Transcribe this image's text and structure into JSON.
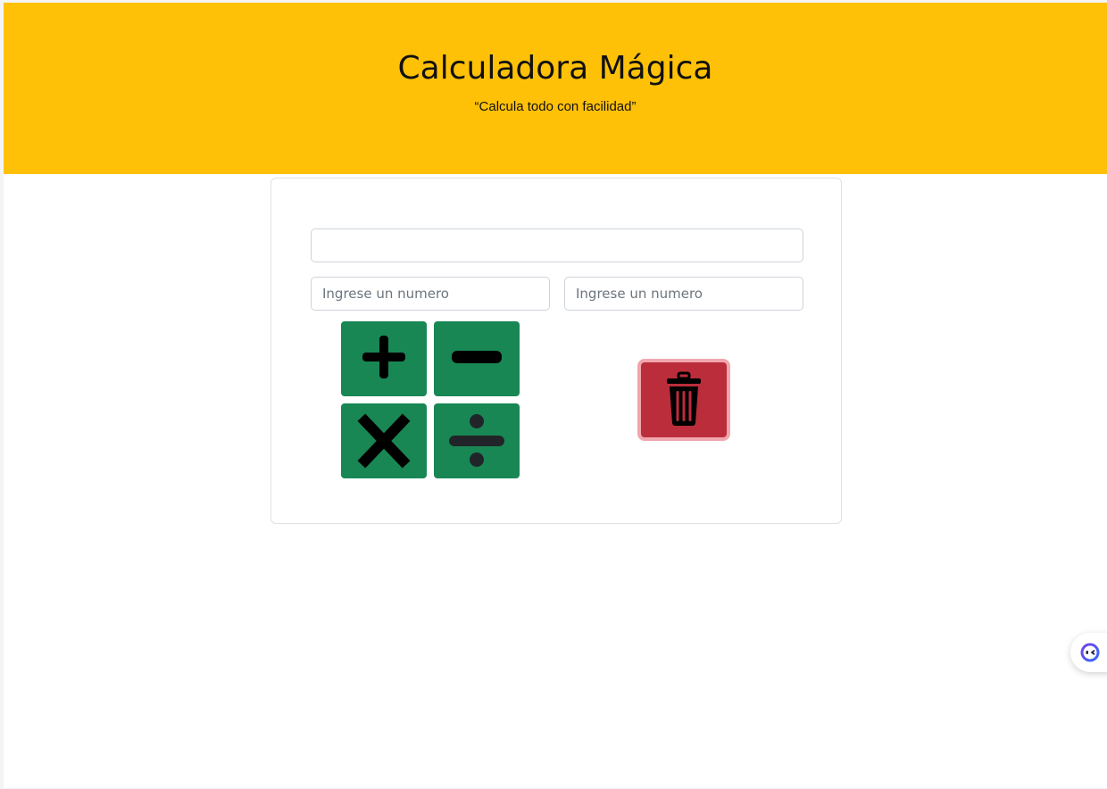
{
  "header": {
    "title": "Calculadora Mágica",
    "subtitle": "“Calcula todo con facilidad”"
  },
  "calculator": {
    "result_value": "",
    "num1_placeholder": "Ingrese un numero",
    "num2_placeholder": "Ingrese un numero",
    "operations": [
      {
        "name": "add",
        "icon": "plus-icon"
      },
      {
        "name": "subtract",
        "icon": "minus-icon"
      },
      {
        "name": "multiply",
        "icon": "times-icon"
      },
      {
        "name": "divide",
        "icon": "divide-icon"
      }
    ],
    "clear_icon": "trash-icon"
  },
  "colors": {
    "header_bg": "#ffc107",
    "operation_bg": "#198754",
    "clear_bg": "#bb2d3b",
    "clear_border": "#f1a6ae"
  },
  "widgets": {
    "assistant_icon": "assistant-face-icon"
  }
}
